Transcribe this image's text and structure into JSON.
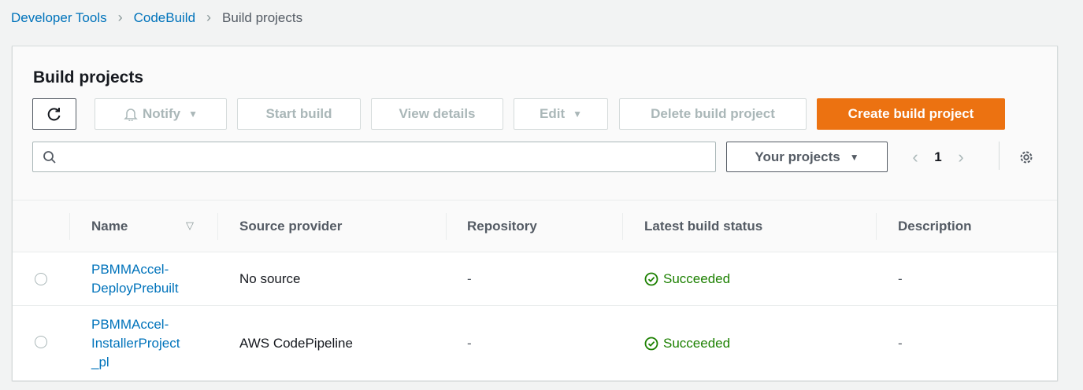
{
  "breadcrumb": {
    "items": [
      "Developer Tools",
      "CodeBuild",
      "Build projects"
    ]
  },
  "panel": {
    "title": "Build projects"
  },
  "toolbar": {
    "notify_label": "Notify",
    "start_build_label": "Start build",
    "view_details_label": "View details",
    "edit_label": "Edit",
    "delete_label": "Delete build project",
    "create_label": "Create build project"
  },
  "search": {
    "placeholder": ""
  },
  "filter": {
    "selected": "Your projects"
  },
  "pagination": {
    "current_page": "1"
  },
  "table": {
    "headers": [
      "Name",
      "Source provider",
      "Repository",
      "Latest build status",
      "Description"
    ],
    "rows": [
      {
        "name_lines": [
          "PBMMAccel-",
          "DeployPrebuilt"
        ],
        "source_provider": "No source",
        "repository": "-",
        "status": "Succeeded",
        "description": "-"
      },
      {
        "name_lines": [
          "PBMMAccel-",
          "InstallerProject",
          "_pl"
        ],
        "source_provider": "AWS CodePipeline",
        "repository": "-",
        "status": "Succeeded",
        "description": "-"
      }
    ]
  },
  "colors": {
    "link": "#0073bb",
    "primary": "#ec7211",
    "success": "#1d8102"
  }
}
